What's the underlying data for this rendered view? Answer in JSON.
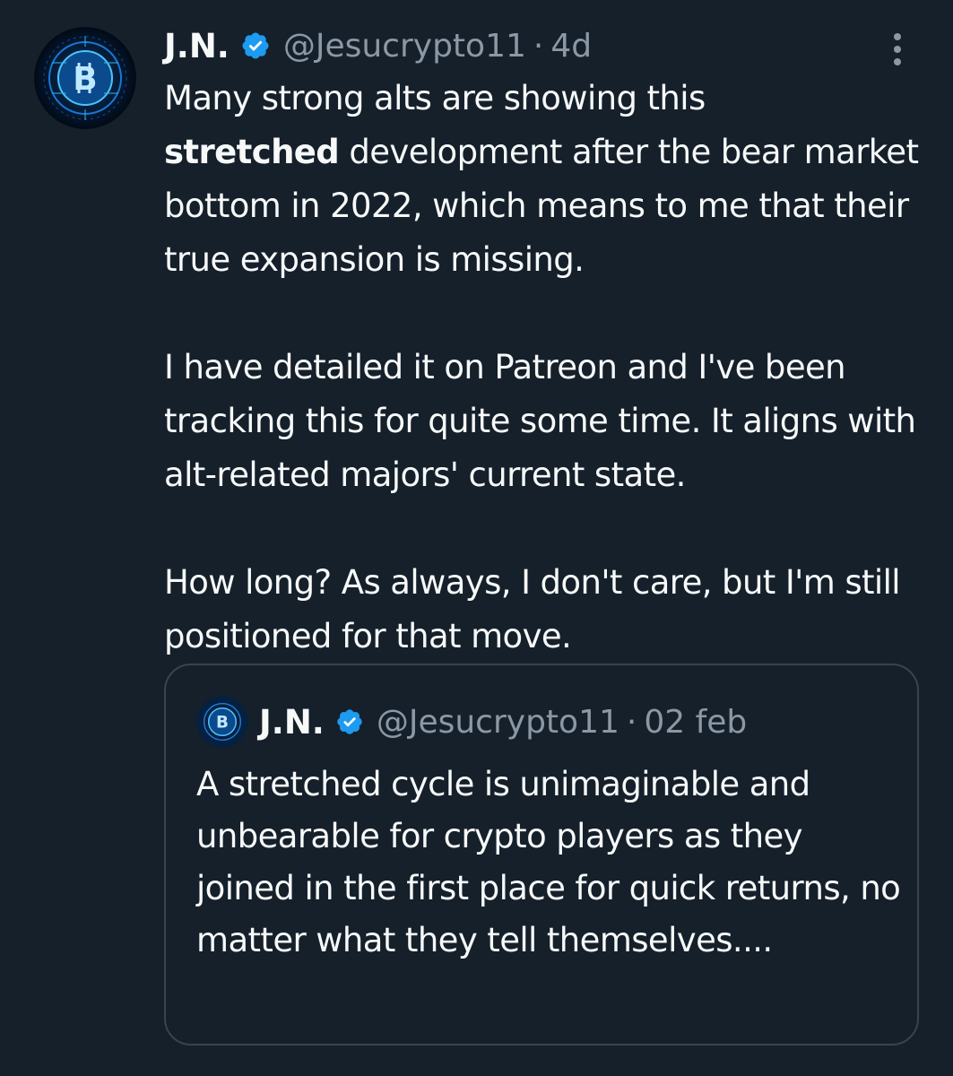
{
  "tweet": {
    "author_name": "J.N.",
    "handle": "@Jesucrypto11",
    "separator": "·",
    "time": "4d",
    "paragraphs": {
      "p1_bold": "stretched",
      "p1_before": "Many strong alts are showing this",
      "p1_after": " development after the bear market bottom in 2022, which means to me that their true expansion is missing.",
      "p2": "I have detailed it on Patreon and I've been tracking this for quite some time. It aligns with alt-related majors' current state.",
      "p3": "How long? As always, I don't care, but I'm still positioned for that move."
    }
  },
  "quoted_tweet": {
    "author_name": "J.N.",
    "handle": "@Jesucrypto11",
    "separator": "·",
    "time": "02 feb",
    "text": "A stretched cycle is unimaginable and unbearable for crypto players as they joined in the first place for quick returns, no matter what they tell themselves...."
  },
  "icons": {
    "avatar": "bitcoin-avatar-icon",
    "verified": "verified-badge-icon",
    "more": "more-options-icon"
  },
  "colors": {
    "background": "#15202b",
    "text_primary": "#f7f9f9",
    "text_secondary": "#8b98a5",
    "verified_blue": "#1d9bf0",
    "border": "#38444d"
  }
}
